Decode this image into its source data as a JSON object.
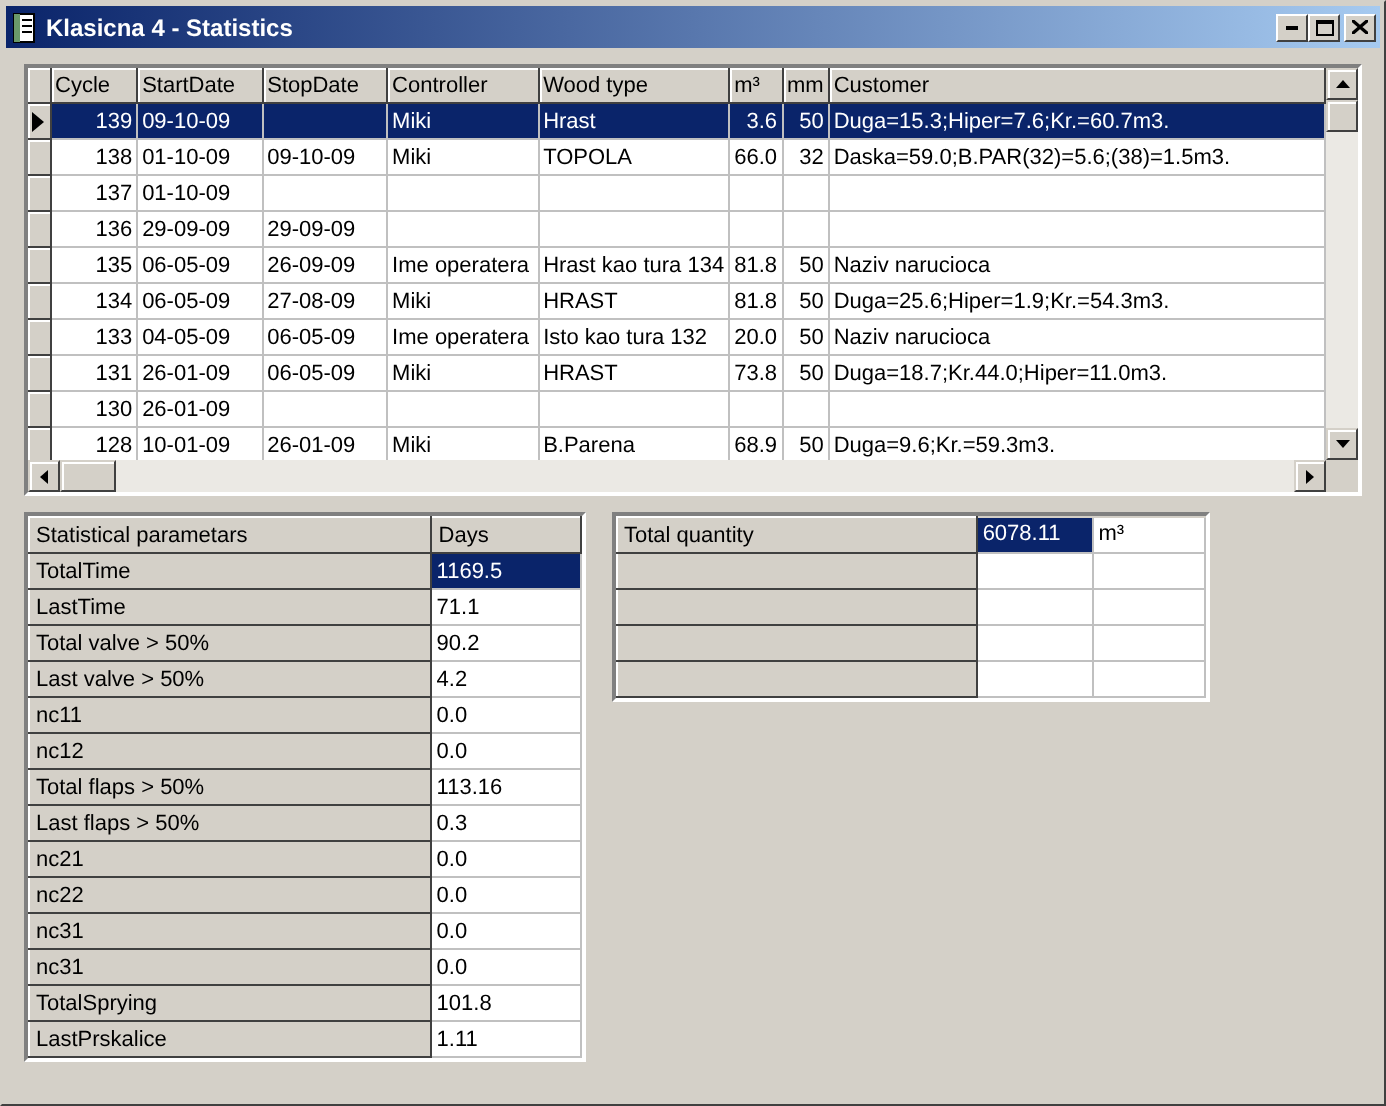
{
  "window": {
    "title": "Klasicna 4 - Statistics"
  },
  "cycles": {
    "columns": [
      "Cycle",
      "StartDate",
      "StopDate",
      "Controller",
      "Wood type",
      "m³",
      "mm",
      "Customer"
    ],
    "rows": [
      {
        "selected": true,
        "cells": [
          "139",
          "09-10-09",
          "",
          "Miki",
          "Hrast",
          "3.6",
          "50",
          "Duga=15.3;Hiper=7.6;Kr.=60.7m3."
        ]
      },
      {
        "selected": false,
        "cells": [
          "138",
          "01-10-09",
          "09-10-09",
          "Miki",
          "TOPOLA",
          "66.0",
          "32",
          "Daska=59.0;B.PAR(32)=5.6;(38)=1.5m3."
        ]
      },
      {
        "selected": false,
        "cells": [
          "137",
          "01-10-09",
          "",
          "",
          "",
          "",
          "",
          ""
        ]
      },
      {
        "selected": false,
        "cells": [
          "136",
          "29-09-09",
          "29-09-09",
          "",
          "",
          "",
          "",
          ""
        ]
      },
      {
        "selected": false,
        "cells": [
          "135",
          "06-05-09",
          "26-09-09",
          "Ime operatera",
          "Hrast kao tura 134",
          "81.8",
          "50",
          "Naziv narucioca"
        ]
      },
      {
        "selected": false,
        "cells": [
          "134",
          "06-05-09",
          "27-08-09",
          "Miki",
          "HRAST",
          "81.8",
          "50",
          "Duga=25.6;Hiper=1.9;Kr.=54.3m3."
        ]
      },
      {
        "selected": false,
        "cells": [
          "133",
          "04-05-09",
          "06-05-09",
          "Ime operatera",
          "Isto kao tura 132",
          "20.0",
          "50",
          "Naziv narucioca"
        ]
      },
      {
        "selected": false,
        "cells": [
          "131",
          "26-01-09",
          "06-05-09",
          "Miki",
          "HRAST",
          "73.8",
          "50",
          "Duga=18.7;Kr.44.0;Hiper=11.0m3."
        ]
      },
      {
        "selected": false,
        "cells": [
          "130",
          "26-01-09",
          "",
          "",
          "",
          "",
          "",
          ""
        ]
      },
      {
        "selected": false,
        "cells": [
          "128",
          "10-01-09",
          "26-01-09",
          "Miki",
          "B.Parena",
          "68.9",
          "50",
          "Duga=9.6;Kr.=59.3m3."
        ]
      }
    ]
  },
  "statistics": {
    "columns": [
      "Statistical parametars",
      "Days"
    ],
    "rows": [
      {
        "label": "TotalTime",
        "value": "1169.5",
        "selected": true
      },
      {
        "label": "LastTime",
        "value": "71.1",
        "selected": false
      },
      {
        "label": "Total valve > 50%",
        "value": "90.2",
        "selected": false
      },
      {
        "label": "Last valve > 50%",
        "value": "4.2",
        "selected": false
      },
      {
        "label": "nc11",
        "value": "0.0",
        "selected": false
      },
      {
        "label": "nc12",
        "value": "0.0",
        "selected": false
      },
      {
        "label": "Total flaps > 50%",
        "value": "113.16",
        "selected": false
      },
      {
        "label": "Last flaps > 50%",
        "value": "0.3",
        "selected": false
      },
      {
        "label": "nc21",
        "value": "0.0",
        "selected": false
      },
      {
        "label": "nc22",
        "value": "0.0",
        "selected": false
      },
      {
        "label": "nc31",
        "value": "0.0",
        "selected": false
      },
      {
        "label": "nc31",
        "value": "0.0",
        "selected": false
      },
      {
        "label": "TotalSprying",
        "value": "101.8",
        "selected": false
      },
      {
        "label": "LastPrskalice",
        "value": "1.11",
        "selected": false
      }
    ]
  },
  "quantity": {
    "rows": [
      {
        "label": "Total quantity",
        "value": "6078.11",
        "unit": "m³",
        "selected": true
      }
    ]
  }
}
